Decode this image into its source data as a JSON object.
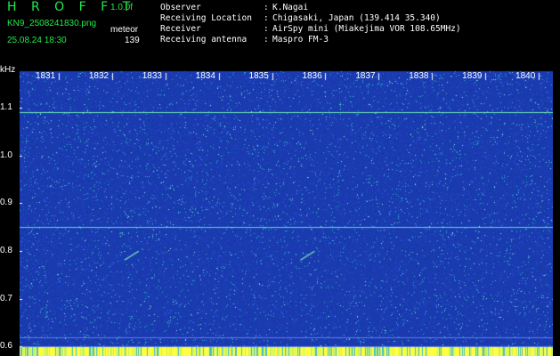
{
  "header": {
    "title": "H R O F F T",
    "version": "1.0.0f",
    "filename": "KN9_2508241830.png",
    "meteor_label": "meteor",
    "timestamp": "25.08.24 18:30",
    "count": "139"
  },
  "info": {
    "rows": [
      {
        "key": "Observer",
        "value": "K.Nagai"
      },
      {
        "key": "Receiving Location",
        "value": "Chigasaki, Japan (139.414 35.340)"
      },
      {
        "key": "Receiver",
        "value": "AirSpy mini (Miakejima VOR 108.65MHz)"
      },
      {
        "key": "Receiving antenna",
        "value": "Maspro FM-3"
      }
    ]
  },
  "colors": {
    "background": "#000000",
    "waterfall_base": "#1a3ab0",
    "speckle": "#2fc0c8",
    "highlight": "#ffff40",
    "header_green": "#22e84a"
  },
  "chart_data": {
    "type": "heatmap",
    "ylabel": "kHz",
    "y_ticks": [
      "1.1",
      "1.0",
      "0.9",
      "0.8",
      "0.7",
      "0.6"
    ],
    "x_ticks": [
      "1831",
      "1832",
      "1833",
      "1834",
      "1835",
      "1836",
      "1837",
      "1838",
      "1839",
      "1840"
    ],
    "ylim": [
      0.58,
      1.18
    ],
    "xlim": [
      1830.5,
      1840.5
    ],
    "horizontal_lines_khz": [
      1.09,
      0.85,
      0.62,
      0.6
    ],
    "meteor_echoes": [
      {
        "time": 1832.6,
        "khz": 0.79
      },
      {
        "time": 1835.9,
        "khz": 0.79
      }
    ]
  }
}
